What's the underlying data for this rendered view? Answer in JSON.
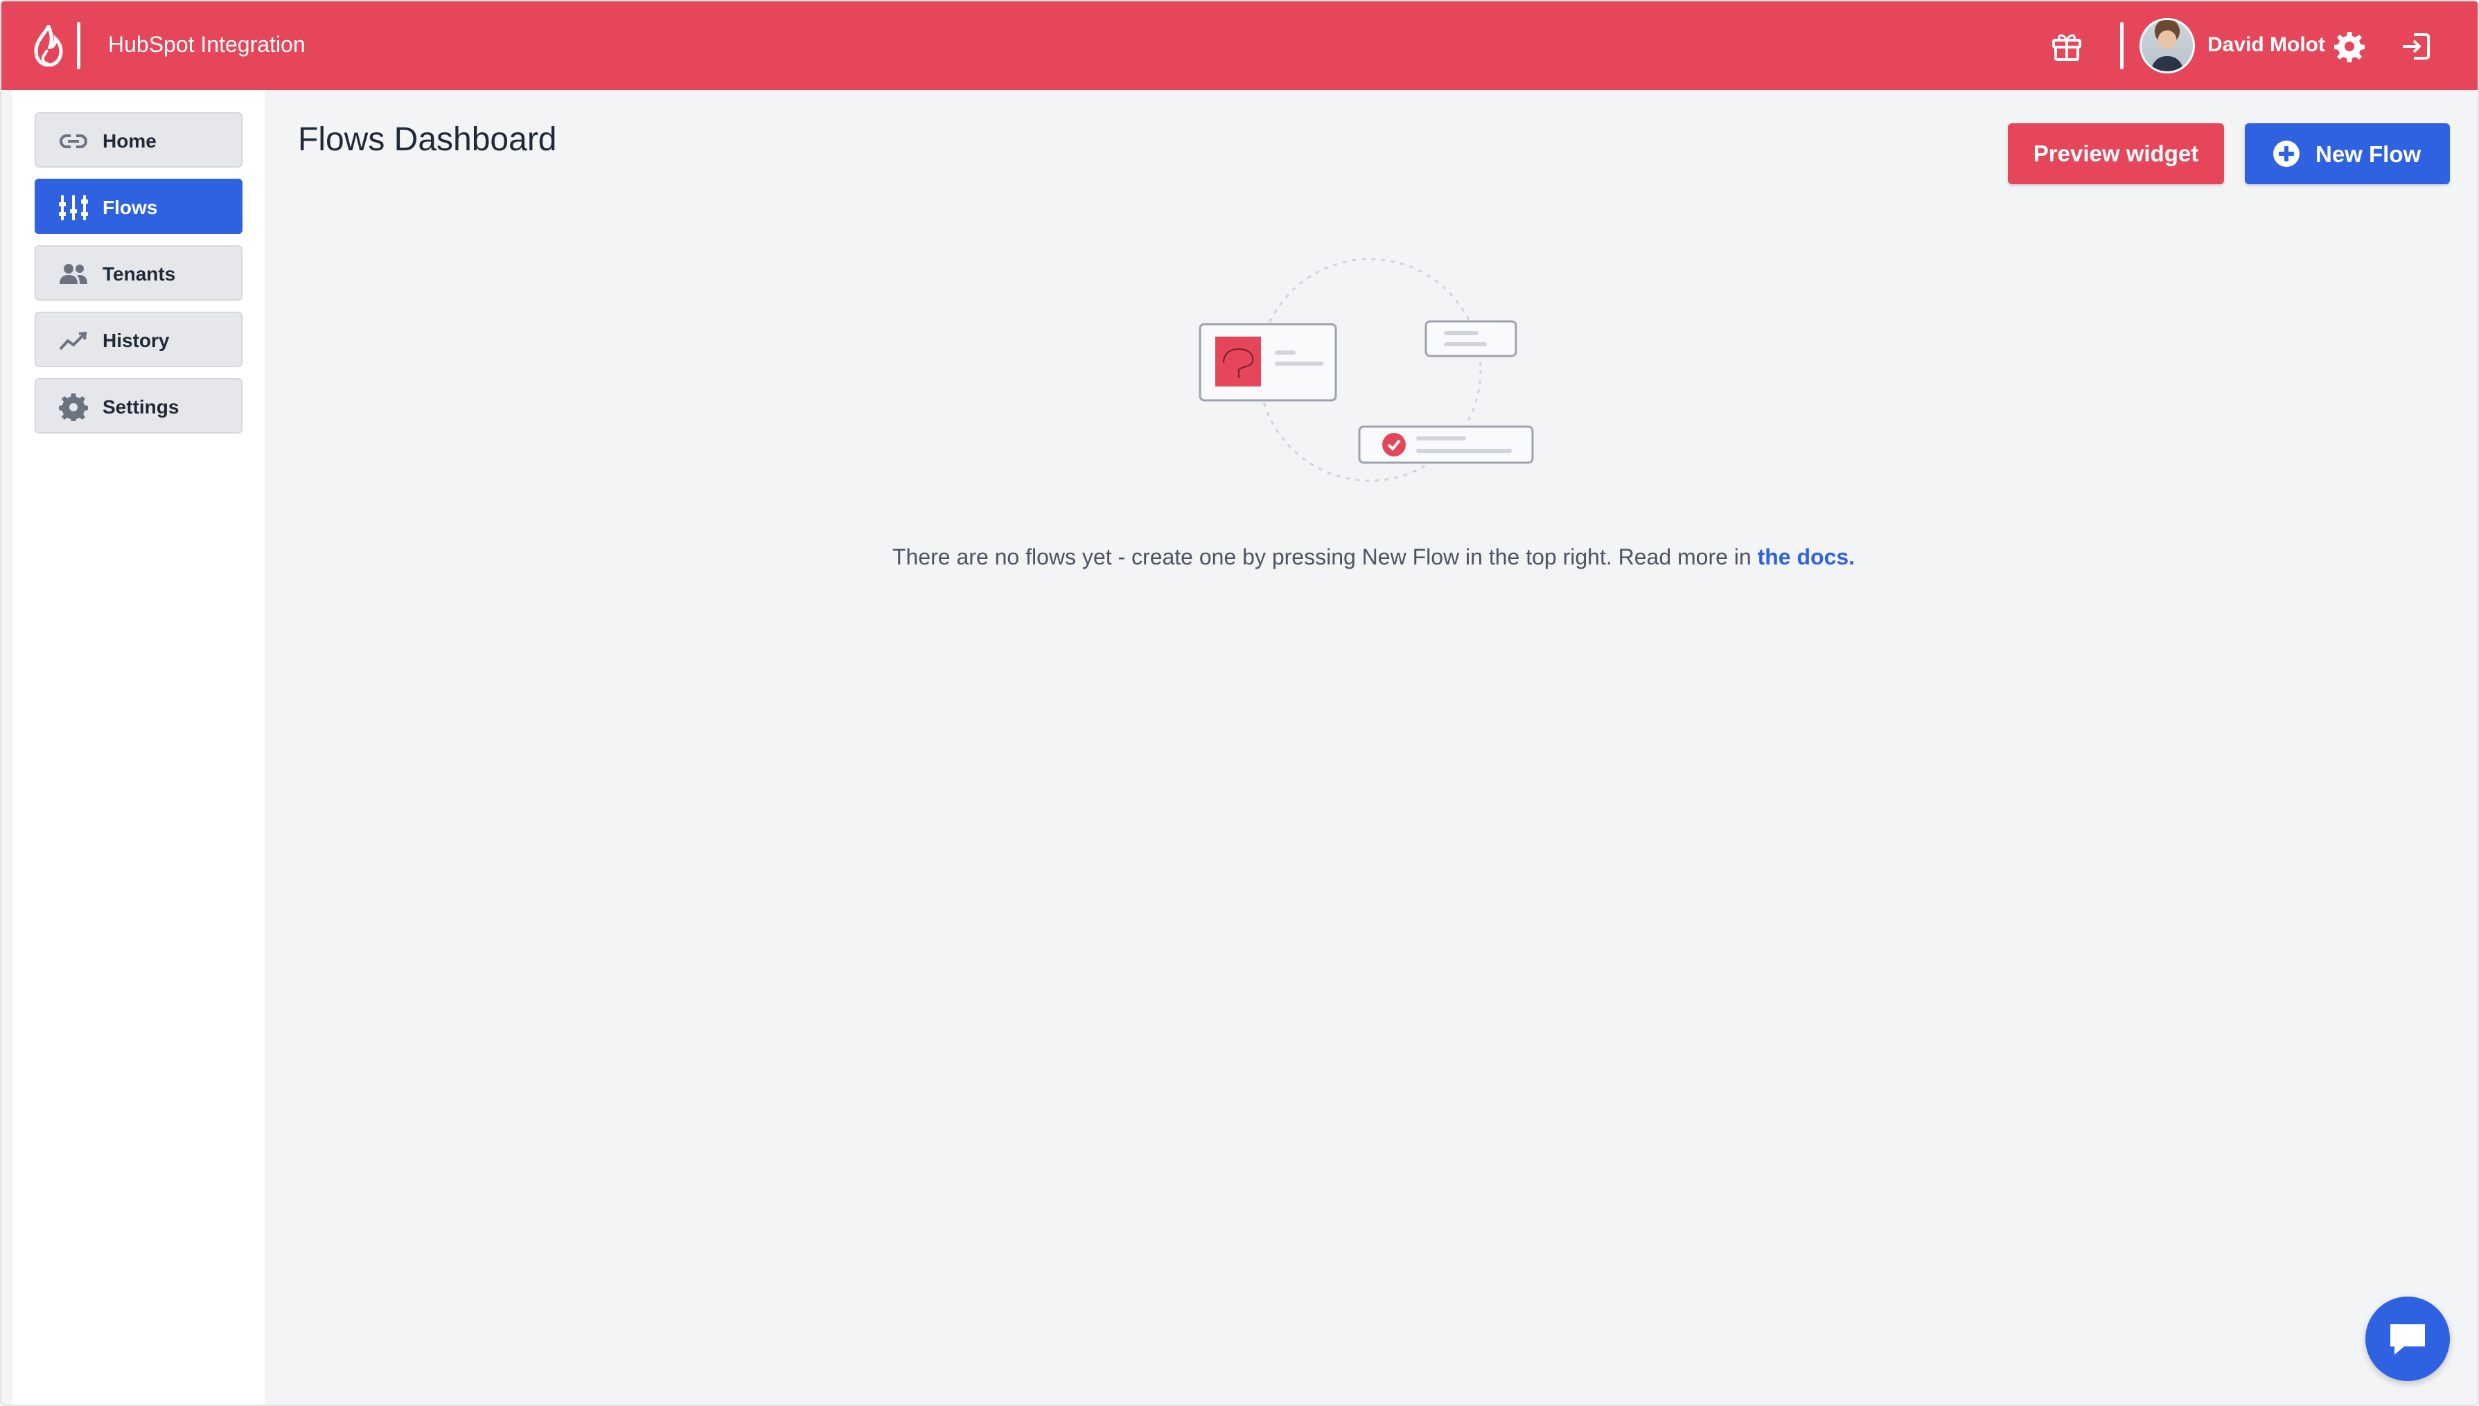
{
  "header": {
    "app_title": "HubSpot Integration",
    "user_name": "David Molot",
    "icons": [
      "flame-logo-icon",
      "gift-icon",
      "avatar",
      "gear-icon",
      "logout-icon"
    ],
    "bar_color": "#e5465a"
  },
  "sidebar": {
    "items": [
      {
        "label": "Home",
        "icon": "link-icon",
        "active": false
      },
      {
        "label": "Flows",
        "icon": "flows-icon",
        "active": true
      },
      {
        "label": "Tenants",
        "icon": "users-icon",
        "active": false
      },
      {
        "label": "History",
        "icon": "chart-line-icon",
        "active": false
      },
      {
        "label": "Settings",
        "icon": "gear-icon",
        "active": false
      }
    ],
    "active_color": "#2f62e0"
  },
  "main": {
    "title": "Flows Dashboard",
    "preview_label": "Preview widget",
    "new_flow_label": "New Flow",
    "empty_message": "There are no flows yet - create one by pressing New Flow in the top right. Read more in",
    "docs_link": "the docs."
  },
  "chat": {
    "icon": "chat-icon"
  }
}
